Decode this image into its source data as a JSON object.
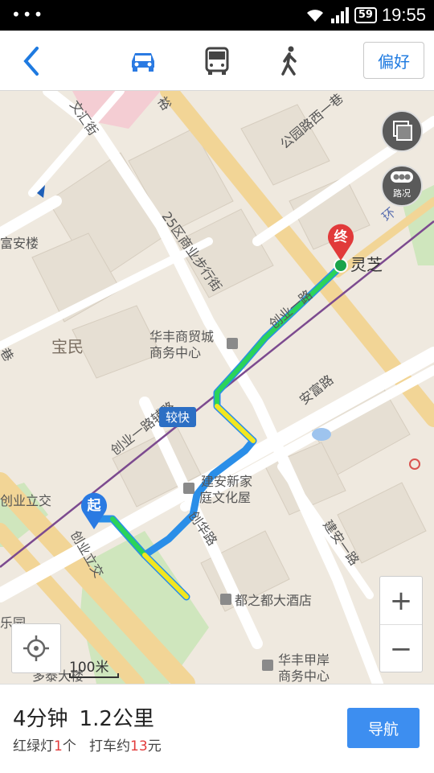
{
  "status_bar": {
    "signal_dots": "•••",
    "battery": "59",
    "time": "19:55"
  },
  "top_bar": {
    "modes": [
      {
        "name": "car",
        "icon": "car-icon",
        "active": true
      },
      {
        "name": "bus",
        "icon": "bus-icon",
        "active": false
      },
      {
        "name": "walk",
        "icon": "walk-icon",
        "active": false
      }
    ],
    "preference_label": "偏好",
    "accent_color": "#1e7ae0"
  },
  "map": {
    "labels": {
      "wenhui_street": "文汇街",
      "yu_road": "裕",
      "gongyuan_road": "公园路西一巷",
      "district25": "25区商业步行街",
      "fuan_building": "富安楼",
      "baomin": "宝民",
      "huafeng": "华丰商贸城",
      "huafeng2": "商务中心",
      "chuangye_road": "创业一路",
      "chuangye_aux": "创业一路辅路",
      "anfu_road": "安富路",
      "jianan_house": "建安新家",
      "jianan_house2": "庭文化屋",
      "chuanghua_road": "创华路",
      "chuangye_bus": "创业立交",
      "chuangye_bus2": "创业立交",
      "duzhidu_hotel": "都之都大酒店",
      "huafeng_jiaan": "华丰甲岸",
      "huafeng_jiaan2": "商务中心",
      "duotai": "多泰大楼",
      "leyuan": "乐园",
      "jianan_road": "建安一路",
      "lingzhi": "灵芝",
      "xiang": "巷",
      "huan": "环",
      "metro_station": "灵芝"
    },
    "start_marker": "起",
    "end_marker": "终",
    "traffic_badge": "较快",
    "traffic_button_label": "路况",
    "scale_label": "100米",
    "zoom_in": "+",
    "zoom_out": "−",
    "route_colors": {
      "fast": "#2bd35a",
      "slow": "#f2e61f",
      "normal": "#2a8ee8"
    }
  },
  "bottom_panel": {
    "duration": "4分钟",
    "distance": "1.2公里",
    "lights_prefix": "红绿灯",
    "lights_count": "1",
    "lights_suffix": "个",
    "taxi_prefix": "打车约",
    "taxi_amount": "13",
    "taxi_suffix": "元",
    "navigate_label": "导航"
  }
}
